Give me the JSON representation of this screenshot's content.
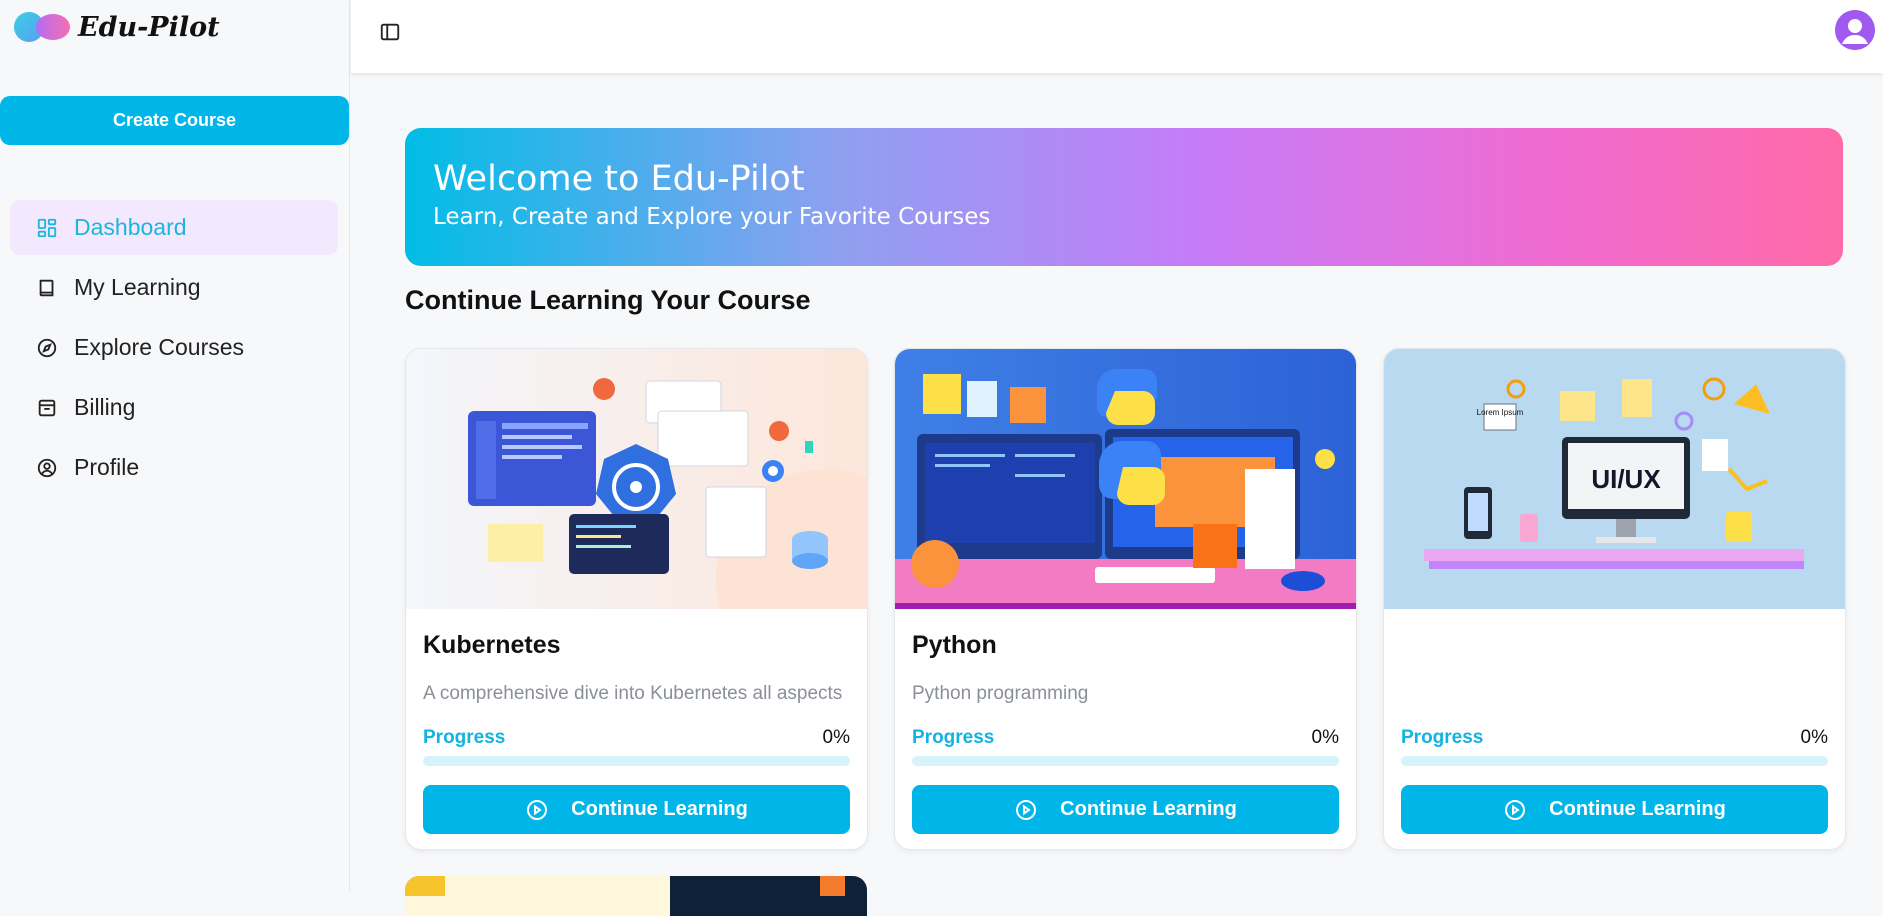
{
  "app": {
    "name": "Edu-Pilot",
    "create_course_label": "Create Course"
  },
  "sidebar": {
    "items": [
      {
        "label": "Dashboard",
        "icon": "dashboard-icon",
        "active": true
      },
      {
        "label": "My Learning",
        "icon": "book-icon",
        "active": false
      },
      {
        "label": "Explore Courses",
        "icon": "compass-icon",
        "active": false
      },
      {
        "label": "Billing",
        "icon": "billing-icon",
        "active": false
      },
      {
        "label": "Profile",
        "icon": "user-circle-icon",
        "active": false
      }
    ]
  },
  "banner": {
    "title_prefix": "Welcome to ",
    "title_brand": "Edu-Pilot",
    "subtitle": "Learn, Create and Explore your Favorite Courses"
  },
  "section": {
    "title": "Continue Learning Your Course"
  },
  "courses": [
    {
      "title": "Kubernetes",
      "description": "A comprehensive dive into Kubernetes all aspects",
      "progress_label": "Progress",
      "progress_value": "0%",
      "progress": 0,
      "cta": "Continue Learning"
    },
    {
      "title": "Python",
      "description": "Python programming",
      "progress_label": "Progress",
      "progress_value": "0%",
      "progress": 0,
      "cta": "Continue Learning",
      "thumb_text": ""
    },
    {
      "title": "",
      "description": "",
      "progress_label": "Progress",
      "progress_value": "0%",
      "progress": 0,
      "cta": "Continue Learning",
      "thumb_text": "UI/UX",
      "thumb_note": "Lorem Ipsum"
    }
  ],
  "colors": {
    "accent": "#00b5e8",
    "active_nav_bg": "#f3e8fd",
    "active_nav_text": "#1ab6de"
  }
}
